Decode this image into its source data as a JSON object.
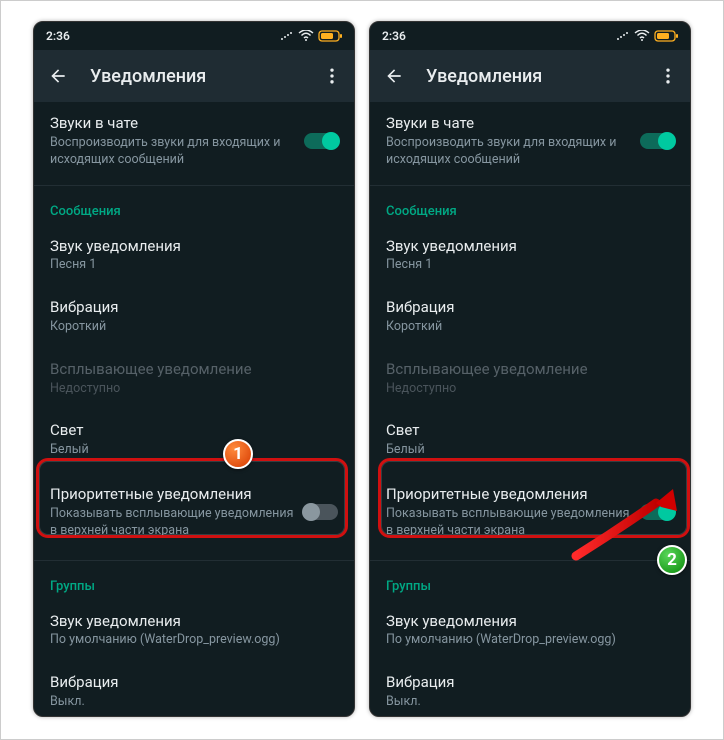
{
  "status": {
    "time": "2:36"
  },
  "appbar": {
    "title": "Уведомления"
  },
  "chat_sounds": {
    "label": "Звуки в чате",
    "sub": "Воспроизводить звуки для входящих и исходящих сообщений"
  },
  "sections": {
    "messages": "Сообщения",
    "groups": "Группы"
  },
  "msg": {
    "sound_label": "Звук уведомления",
    "sound_value": "Песня 1",
    "vibration_label": "Вибрация",
    "vibration_value": "Короткий",
    "popup_label": "Всплывающее уведомление",
    "popup_value": "Недоступно",
    "light_label": "Свет",
    "light_value": "Белый",
    "priority_label": "Приоритетные уведомления",
    "priority_sub": "Показывать всплывающие уведомления в верхней части экрана"
  },
  "grp": {
    "sound_label": "Звук уведомления",
    "sound_value": "По умолчанию (WaterDrop_preview.ogg)",
    "vibration_label": "Вибрация",
    "vibration_value": "Выкл."
  },
  "badges": {
    "one": "1",
    "two": "2"
  }
}
